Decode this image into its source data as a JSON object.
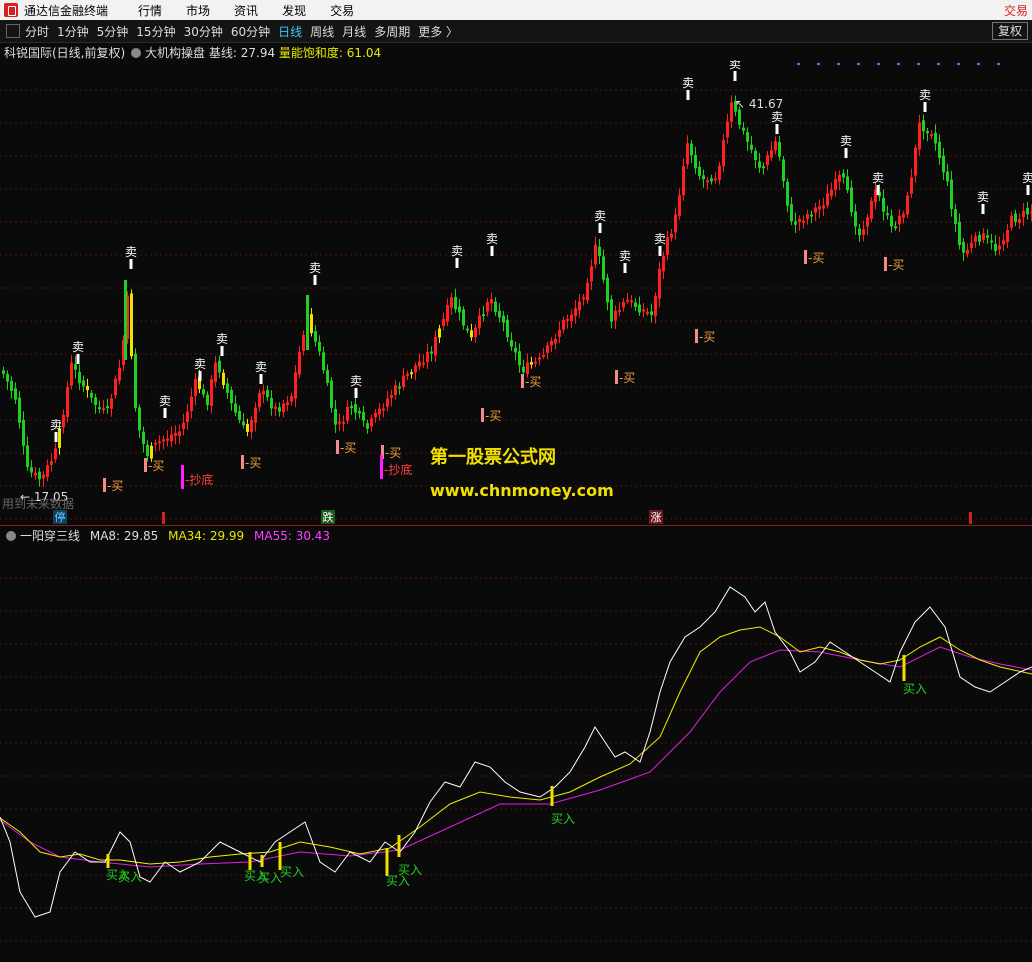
{
  "titlebar": {
    "app_name": "通达信金融终端",
    "menus": [
      "行情",
      "市场",
      "资讯",
      "发现",
      "交易"
    ],
    "right_label": "交易"
  },
  "periods": {
    "items": [
      "分时",
      "1分钟",
      "5分钟",
      "15分钟",
      "30分钟",
      "60分钟",
      "日线",
      "周线",
      "月线",
      "多周期",
      "更多 〉"
    ],
    "active": "日线",
    "fq_button": "复权"
  },
  "main_panel": {
    "stock": "科锐国际(日线,前复权)",
    "indicator": "大机构操盘",
    "base_label": "基线:",
    "base_value": "27.94",
    "energy_label": "量能饱和度:",
    "energy_value": "61.04",
    "high_label": "41.67",
    "low_label": "17.05",
    "sell_label": "卖",
    "buy_label": "-买",
    "bottom_label": "-抄底",
    "watermark_cn": "第一股票公式网",
    "watermark_url": "www.chnmoney.com",
    "footer_left": "用到未来数据",
    "date_markers": [
      "停",
      "跌",
      "涨"
    ],
    "colors": {
      "up": "#ff2020",
      "down": "#20d020",
      "yellow": "#f0e000",
      "buy": "#f08c8c",
      "bottom": "#ff20ff",
      "grid": "#5a1010"
    }
  },
  "sub_panel": {
    "indicator": "一阳穿三线",
    "ma8_label": "MA8:",
    "ma8_value": "29.85",
    "ma34_label": "MA34:",
    "ma34_value": "29.99",
    "ma55_label": "MA55:",
    "ma55_value": "30.43",
    "buy_label": "买入",
    "colors": {
      "ma8": "#ffffff",
      "ma34": "#f0f000",
      "ma55": "#e020e0",
      "buy_text": "#20d020"
    }
  }
}
